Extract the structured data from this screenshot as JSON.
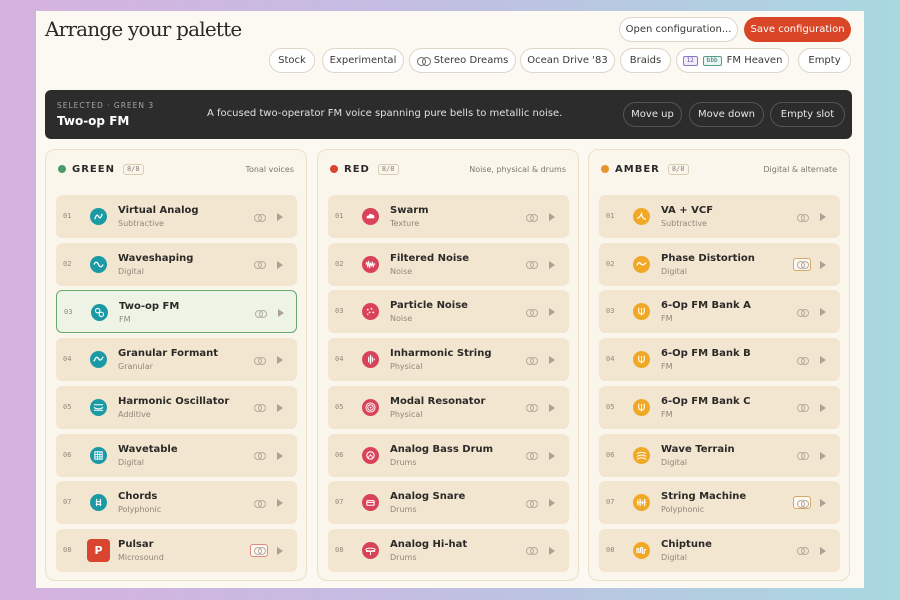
{
  "app": {
    "title": "Arrange your palette"
  },
  "header": {
    "open_label": "Open configuration...",
    "save_label": "Save configuration"
  },
  "presets": [
    {
      "label": "Stock"
    },
    {
      "label": "Experimental"
    },
    {
      "label": "Stereo Dreams",
      "icon": "link-icon"
    },
    {
      "label": "Ocean Drive '83"
    },
    {
      "label": "Braids"
    },
    {
      "label": "FM Heaven",
      "badges": [
        "12",
        "bbb"
      ]
    },
    {
      "label": "Empty"
    }
  ],
  "selection": {
    "meta": "SELECTED · GREEN 3",
    "name": "Two-op FM",
    "description": "A focused two-operator FM voice spanning pure bells to metallic noise.",
    "actions": [
      "Move up",
      "Move down",
      "Empty slot"
    ]
  },
  "columns": [
    {
      "name": "GREEN",
      "count": "8/8",
      "description": "Tonal voices",
      "color": "#4a9a6b",
      "icon_color": "#1b9aa6",
      "slots": [
        {
          "num": "01",
          "name": "Virtual Analog",
          "type": "Subtractive",
          "icon": "va-icon"
        },
        {
          "num": "02",
          "name": "Waveshaping",
          "type": "Digital",
          "icon": "sine-icon"
        },
        {
          "num": "03",
          "name": "Two-op FM",
          "type": "FM",
          "icon": "operators-icon",
          "selected": true
        },
        {
          "num": "04",
          "name": "Granular Formant",
          "type": "Granular",
          "icon": "formant-icon"
        },
        {
          "num": "05",
          "name": "Harmonic Oscillator",
          "type": "Additive",
          "icon": "harmonic-icon"
        },
        {
          "num": "06",
          "name": "Wavetable",
          "type": "Digital",
          "icon": "grid-icon"
        },
        {
          "num": "07",
          "name": "Chords",
          "type": "Polyphonic",
          "icon": "chords-icon"
        },
        {
          "num": "08",
          "name": "Pulsar",
          "type": "Microsound",
          "icon": "p-icon",
          "icon_letter": "P",
          "link_box": true
        }
      ]
    },
    {
      "name": "RED",
      "count": "8/8",
      "description": "Noise, physical & drums",
      "color": "#d9452f",
      "icon_color": "#d8435a",
      "slots": [
        {
          "num": "01",
          "name": "Swarm",
          "type": "Texture",
          "icon": "cloud-icon"
        },
        {
          "num": "02",
          "name": "Filtered Noise",
          "type": "Noise",
          "icon": "noise-icon"
        },
        {
          "num": "03",
          "name": "Particle Noise",
          "type": "Noise",
          "icon": "particles-icon"
        },
        {
          "num": "04",
          "name": "Inharmonic String",
          "type": "Physical",
          "icon": "string-icon"
        },
        {
          "num": "05",
          "name": "Modal Resonator",
          "type": "Physical",
          "icon": "rings-icon"
        },
        {
          "num": "06",
          "name": "Analog Bass Drum",
          "type": "Drums",
          "icon": "kick-icon"
        },
        {
          "num": "07",
          "name": "Analog Snare",
          "type": "Drums",
          "icon": "snare-icon"
        },
        {
          "num": "08",
          "name": "Analog Hi-hat",
          "type": "Drums",
          "icon": "hihat-icon"
        }
      ]
    },
    {
      "name": "AMBER",
      "count": "8/8",
      "description": "Digital & alternate",
      "color": "#e6952e",
      "icon_color": "#f0a827",
      "slots": [
        {
          "num": "01",
          "name": "VA + VCF",
          "type": "Subtractive",
          "icon": "vcf-icon"
        },
        {
          "num": "02",
          "name": "Phase Distortion",
          "type": "Digital",
          "icon": "phase-icon",
          "link_box": true
        },
        {
          "num": "03",
          "name": "6-Op FM Bank A",
          "type": "FM",
          "icon": "fm-bank-icon"
        },
        {
          "num": "04",
          "name": "6-Op FM Bank B",
          "type": "FM",
          "icon": "fm-bank-icon"
        },
        {
          "num": "05",
          "name": "6-Op FM Bank C",
          "type": "FM",
          "icon": "fm-bank-icon"
        },
        {
          "num": "06",
          "name": "Wave Terrain",
          "type": "Digital",
          "icon": "terrain-icon"
        },
        {
          "num": "07",
          "name": "String Machine",
          "type": "Polyphonic",
          "icon": "string-machine-icon",
          "link_box": true
        },
        {
          "num": "08",
          "name": "Chiptune",
          "type": "Digital",
          "icon": "chip-icon"
        }
      ]
    }
  ]
}
